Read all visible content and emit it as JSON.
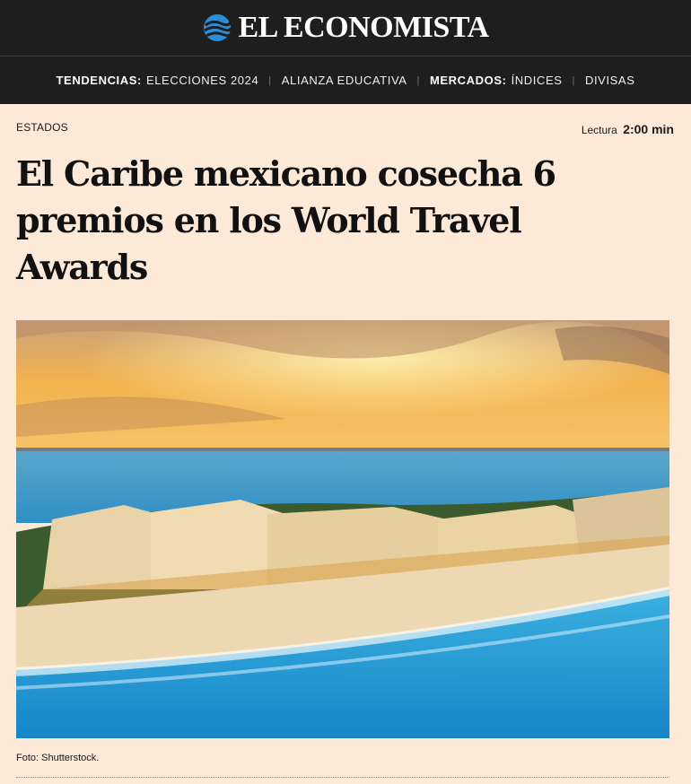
{
  "header": {
    "brand": "EL ECONOMISTA",
    "logo_icon": "globe-wave-icon"
  },
  "nav": {
    "tendencias_label": "TENDENCIAS:",
    "items_a": [
      "ELECCIONES 2024",
      "ALIANZA EDUCATIVA"
    ],
    "mercados_label": "MERCADOS:",
    "items_b": [
      "ÍNDICES",
      "DIVISAS"
    ]
  },
  "article": {
    "section": "ESTADOS",
    "reading_label": "Lectura",
    "reading_time": "2:00 min",
    "headline": "El Caribe mexicano cosecha 6 premios en los World Travel Awards",
    "photo_caption": "Foto: Shutterstock."
  },
  "colors": {
    "page_bg": "#fde9d8",
    "header_bg": "#1e1e1e",
    "logo_blue": "#2a8fd8"
  }
}
